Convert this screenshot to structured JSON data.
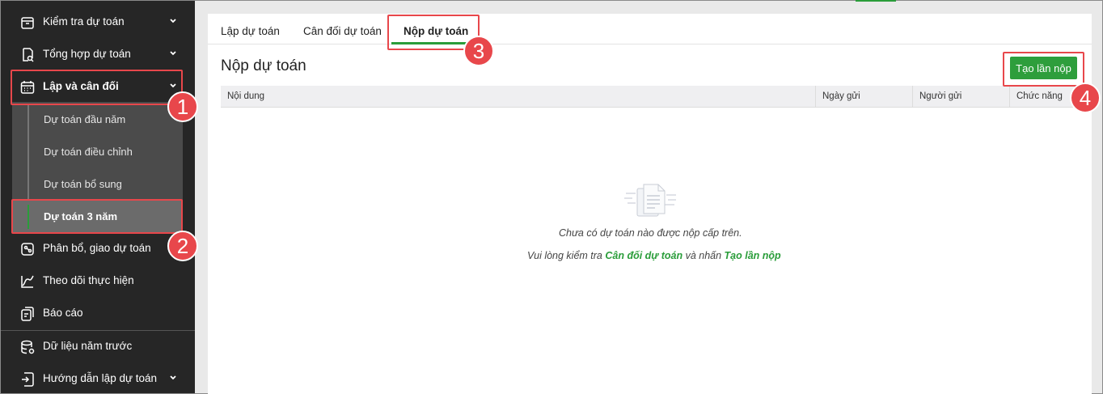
{
  "sidebar": {
    "items": [
      {
        "label": "Kiểm tra dự toán",
        "icon": "box-icon"
      },
      {
        "label": "Tổng hợp dự toán",
        "icon": "doc-search-icon"
      },
      {
        "label": "Lập và cân đối",
        "icon": "calendar-icon"
      },
      {
        "label": "Phân bổ, giao dự toán",
        "icon": "share-doc-icon"
      },
      {
        "label": "Theo dõi thực hiện",
        "icon": "line-chart-icon"
      },
      {
        "label": "Báo cáo",
        "icon": "report-icon"
      },
      {
        "label": "Dữ liệu năm trước",
        "icon": "database-icon"
      },
      {
        "label": "Hướng dẫn lập dự toán",
        "icon": "guide-icon"
      }
    ],
    "sub_items": [
      {
        "label": "Dự toán đầu năm"
      },
      {
        "label": "Dự toán điều chỉnh"
      },
      {
        "label": "Dự toán bổ sung"
      },
      {
        "label": "Dự toán 3 năm"
      }
    ]
  },
  "tabs": [
    {
      "label": "Lập dự toán"
    },
    {
      "label": "Cân đối dự toán"
    },
    {
      "label": "Nộp dự toán"
    }
  ],
  "main": {
    "title": "Nộp dự toán",
    "create_button": "Tạo lần nộp",
    "table": {
      "columns": [
        "Nội dung",
        "Ngày gửi",
        "Người gửi",
        "Chức năng"
      ]
    },
    "empty": {
      "line1": "Chưa có dự toán nào được nộp cấp trên.",
      "line2_prefix": "Vui lòng kiểm tra",
      "line2_link1": "Cân đối dự toán",
      "line2_middle": "và nhấn",
      "line2_link2": "Tạo lần nộp"
    }
  },
  "annotations": {
    "badges": [
      "1",
      "2",
      "3",
      "4"
    ]
  },
  "colors": {
    "accent": "#2a9d3a",
    "annotation": "#e8474b",
    "sidebar_bg": "#262626"
  }
}
